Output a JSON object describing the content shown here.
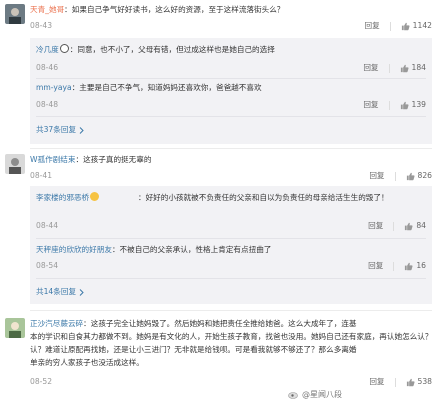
{
  "comments": [
    {
      "user": "天青_她哥",
      "text": "：如果自己争气好好读书，这么好的资源，至于这样流落街头么？",
      "time": "08-43",
      "reply_label": "回复",
      "likes": "1142",
      "replies": [
        {
          "user": "冷几度",
          "text": "：同意，也不小了，父母有错，但过成这样也是她自己的选择",
          "time": "08-46",
          "reply_label": "回复",
          "likes": "184"
        },
        {
          "user": "mm-yaya",
          "text": "：主要是自己不争气，知道妈妈还喜欢你，爸爸越不喜欢",
          "time": "08-48",
          "reply_label": "回复",
          "likes": "139"
        }
      ],
      "more": "共37条回复"
    },
    {
      "user": "W孤作剧结束",
      "text": "：这孩子真的挺无辜的",
      "time": "08-41",
      "reply_label": "回复",
      "likes": "826",
      "replies": [
        {
          "user": "李家楼的邪恶桥",
          "text": "：好好的小孩就被不负责任的父亲和自以为负责任的母亲给活生生的毁了！",
          "time": "08-44",
          "reply_label": "回复",
          "likes": "84"
        },
        {
          "user": "天秤座的欣欣的好朋友",
          "text": "：不被自己的父亲承认，性格上肯定有点扭曲了",
          "time": "08-54",
          "reply_label": "回复",
          "likes": "16"
        }
      ],
      "more": "共14条回复"
    },
    {
      "user": "正沙汽尽蕨云碎",
      "text_lines": [
        "：这孩子完全让她妈毁了。然后她妈和她把责任全推给她爸。这么大成年了，连基",
        "本的学识和自食其力都做不到。她妈是有文化的人，开始生孩子教育，找爸也没用。她妈自己还有家庭，再认她怎么认？",
        "认？难道让原配再找她，还是让小三进门？无非就是给钱呗。可是看我就够不够还了？那么多离婚",
        "单亲的穷人家孩子也没活成这样。"
      ],
      "time": "08-52",
      "reply_label": "回复",
      "likes": "538"
    }
  ],
  "watermark": "@星闻八段",
  "colors": {
    "username": "#eb7350",
    "reply_username": "#3b78a8",
    "more_link": "#3b78a8",
    "reply_bg": "#f2f2f5"
  }
}
